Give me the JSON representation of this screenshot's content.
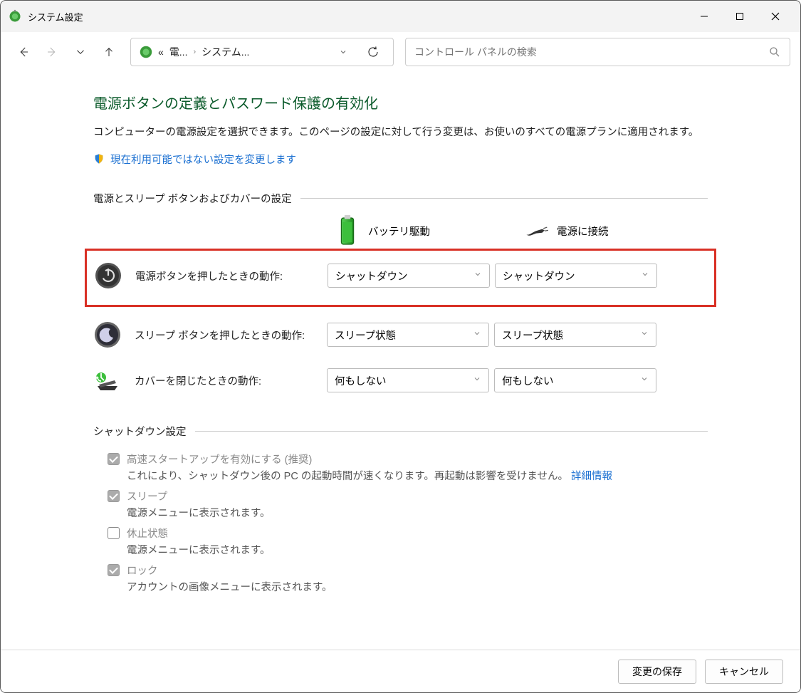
{
  "window": {
    "title": "システム設定"
  },
  "breadcrumb": {
    "prefix": "«",
    "part1": "電...",
    "part2": "システム..."
  },
  "search": {
    "placeholder": "コントロール パネルの検索"
  },
  "page": {
    "heading": "電源ボタンの定義とパスワード保護の有効化",
    "description": "コンピューターの電源設定を選択できます。このページの設定に対して行う変更は、お使いのすべての電源プランに適用されます。",
    "unlock_link": "現在利用可能ではない設定を変更します"
  },
  "section1": {
    "title": "電源とスリープ ボタンおよびカバーの設定",
    "col_battery": "バッテリ駆動",
    "col_plugged": "電源に接続",
    "rows": [
      {
        "label": "電源ボタンを押したときの動作:",
        "battery": "シャットダウン",
        "plugged": "シャットダウン"
      },
      {
        "label": "スリープ ボタンを押したときの動作:",
        "battery": "スリープ状態",
        "plugged": "スリープ状態"
      },
      {
        "label": "カバーを閉じたときの動作:",
        "battery": "何もしない",
        "plugged": "何もしない"
      }
    ]
  },
  "section2": {
    "title": "シャットダウン設定",
    "items": [
      {
        "label": "高速スタートアップを有効にする (推奨)",
        "desc_pre": "これにより、シャットダウン後の PC の起動時間が速くなります。再起動は影響を受けません。",
        "link": "詳細情報",
        "checked": true
      },
      {
        "label": "スリープ",
        "desc_pre": "電源メニューに表示されます。",
        "link": "",
        "checked": true
      },
      {
        "label": "休止状態",
        "desc_pre": "電源メニューに表示されます。",
        "link": "",
        "checked": false
      },
      {
        "label": "ロック",
        "desc_pre": "アカウントの画像メニューに表示されます。",
        "link": "",
        "checked": true
      }
    ]
  },
  "footer": {
    "save": "変更の保存",
    "cancel": "キャンセル"
  }
}
